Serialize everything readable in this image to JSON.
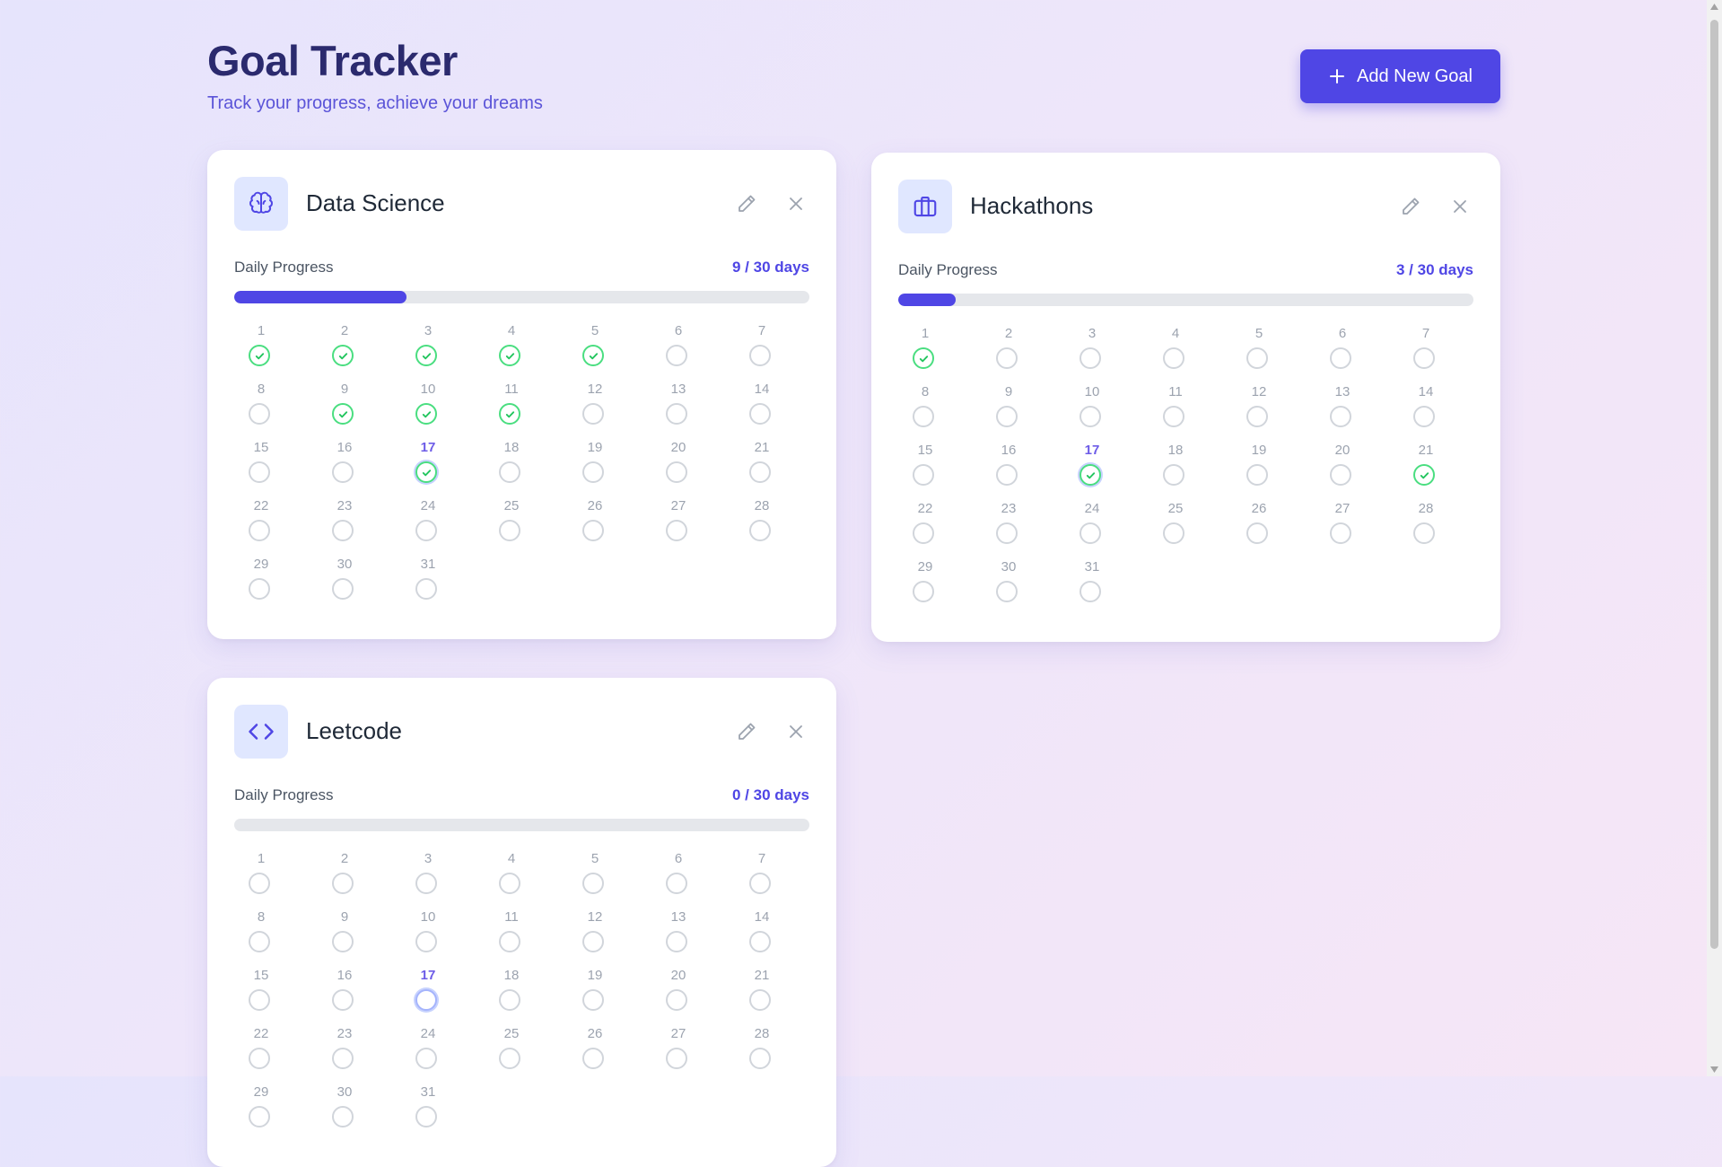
{
  "header": {
    "title": "Goal Tracker",
    "subtitle": "Track your progress, achieve your dreams",
    "add_button_label": "Add New Goal"
  },
  "colors": {
    "accent": "#4f46e5",
    "done": "#4ade80",
    "today_label": "#6d5ce7"
  },
  "progress_label": "Daily Progress",
  "today": 17,
  "goals": [
    {
      "name": "Data Science",
      "icon": "brain-icon",
      "progress_text": "9 / 30 days",
      "progress": 0.3,
      "done_days": [
        1,
        2,
        3,
        4,
        5,
        9,
        10,
        11,
        17
      ]
    },
    {
      "name": "Hackathons",
      "icon": "briefcase-icon",
      "progress_text": "3 / 30 days",
      "progress": 0.1,
      "done_days": [
        1,
        17,
        21
      ]
    },
    {
      "name": "Leetcode",
      "icon": "code-icon",
      "progress_text": "0 / 30 days",
      "progress": 0,
      "done_days": []
    }
  ]
}
